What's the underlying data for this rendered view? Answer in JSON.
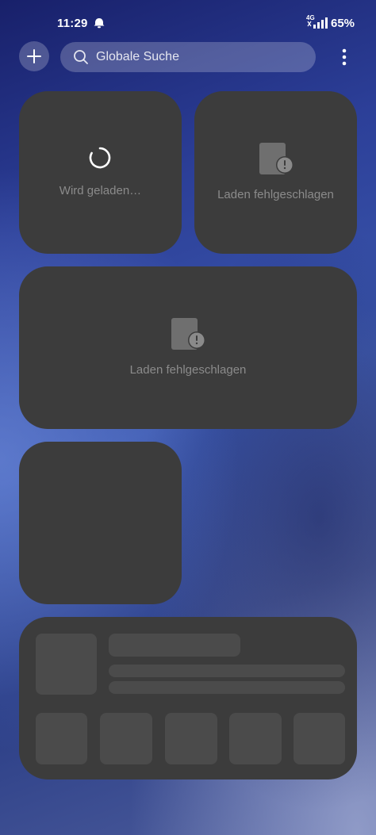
{
  "status_bar": {
    "time": "11:29",
    "network": "4G",
    "battery": "65%",
    "icons": [
      "bell-icon",
      "signal-icon"
    ]
  },
  "header": {
    "add_icon": "plus-icon",
    "search_placeholder": "Globale Suche",
    "search_icon": "search-icon",
    "menu_icon": "more-vert-icon"
  },
  "widgets": {
    "loading_text": "Wird geladen…",
    "error_text_small": "Laden fehlgeschlagen",
    "error_text_large": "Laden fehlgeschlagen"
  },
  "colors": {
    "card": "#3c3c3c",
    "placeholder": "#4b4b4b",
    "muted_text": "#8b8b8b"
  }
}
